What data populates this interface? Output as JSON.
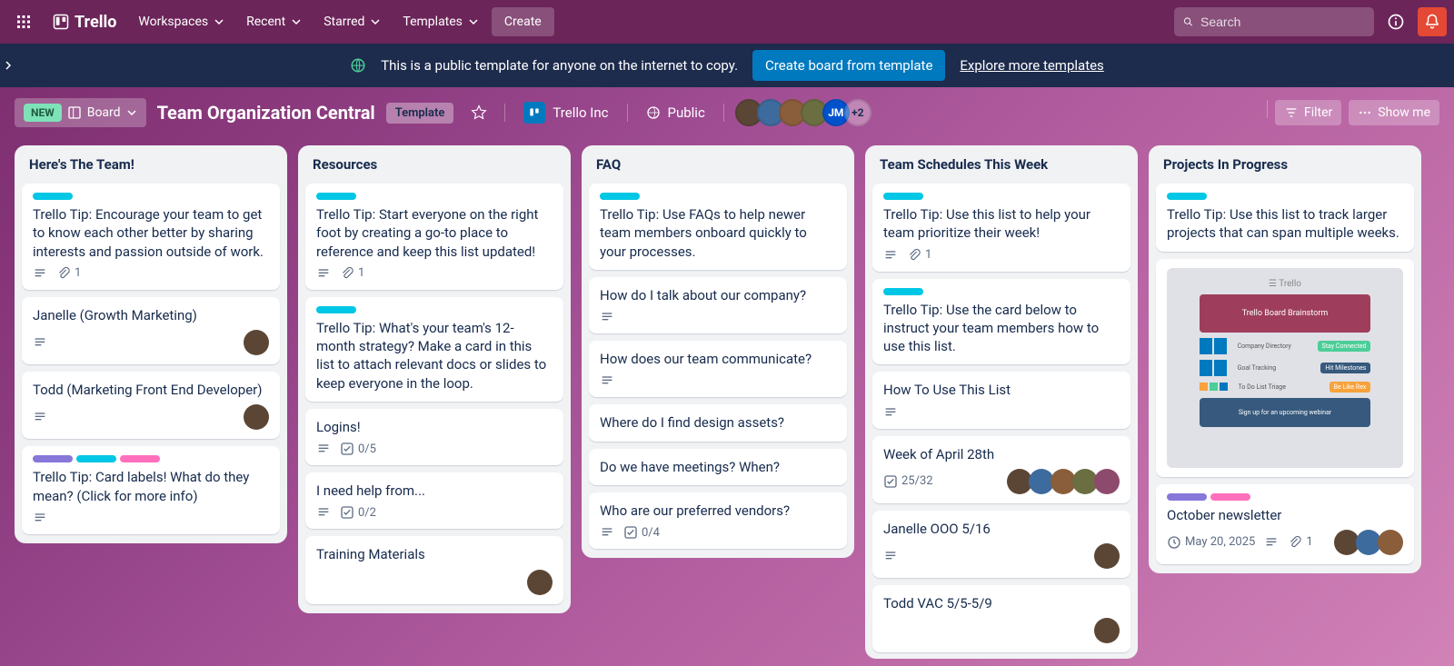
{
  "topnav": {
    "brand": "Trello",
    "menus": [
      "Workspaces",
      "Recent",
      "Starred",
      "Templates"
    ],
    "create": "Create",
    "search_placeholder": "Search"
  },
  "banner": {
    "text": "This is a public template for anyone on the internet to copy.",
    "primary": "Create board from template",
    "link": "Explore more templates"
  },
  "board_header": {
    "badge": "NEW",
    "view": "Board",
    "title": "Team Organization Central",
    "template_chip": "Template",
    "workspace": "Trello Inc",
    "visibility": "Public",
    "member_overflow": "+2",
    "filter": "Filter",
    "show_menu": "Show me"
  },
  "lists": [
    {
      "title": "Here's The Team!",
      "cards": [
        {
          "labels": [
            "cyan"
          ],
          "text": "Trello Tip: Encourage your team to get to know each other better by sharing interests and passion outside of work.",
          "desc": true,
          "attach": "1"
        },
        {
          "text": "Janelle (Growth Marketing)",
          "desc": true,
          "members": 1
        },
        {
          "text": "Todd (Marketing Front End Developer)",
          "desc": true,
          "members": 1
        },
        {
          "labels": [
            "purple",
            "cyan",
            "pink"
          ],
          "text": "Trello Tip: Card labels! What do they mean? (Click for more info)",
          "desc": true
        }
      ]
    },
    {
      "title": "Resources",
      "cards": [
        {
          "labels": [
            "cyan"
          ],
          "text": "Trello Tip: Start everyone on the right foot by creating a go-to place to reference and keep this list updated!",
          "desc": true,
          "attach": "1"
        },
        {
          "labels": [
            "cyan"
          ],
          "text": "Trello Tip: What's your team's 12-month strategy? Make a card in this list to attach relevant docs or slides to keep everyone in the loop."
        },
        {
          "text": "Logins!",
          "desc": true,
          "check": "0/5"
        },
        {
          "text": "I need help from...",
          "desc": true,
          "check": "0/2"
        },
        {
          "text": "Training Materials",
          "members": 1
        }
      ]
    },
    {
      "title": "FAQ",
      "cards": [
        {
          "labels": [
            "cyan"
          ],
          "text": "Trello Tip: Use FAQs to help newer team members onboard quickly to your processes."
        },
        {
          "text": "How do I talk about our company?",
          "desc": true
        },
        {
          "text": "How does our team communicate?",
          "desc": true
        },
        {
          "text": "Where do I find design assets?"
        },
        {
          "text": "Do we have meetings? When?"
        },
        {
          "text": "Who are our preferred vendors?",
          "desc": true,
          "check": "0/4"
        }
      ]
    },
    {
      "title": "Team Schedules This Week",
      "cards": [
        {
          "labels": [
            "cyan"
          ],
          "text": "Trello Tip: Use this list to help your team prioritize their week!",
          "desc": true,
          "attach": "1"
        },
        {
          "labels": [
            "cyan"
          ],
          "text": "Trello Tip: Use the card below to instruct your team members how to use this list."
        },
        {
          "text": "How To Use This List",
          "desc": true
        },
        {
          "text": "Week of April 28th",
          "check": "25/32",
          "members": 5
        },
        {
          "text": "Janelle OOO 5/16",
          "desc": true,
          "members": 1
        },
        {
          "text": "Todd VAC 5/5-5/9",
          "members": 1
        }
      ]
    },
    {
      "title": "Projects In Progress",
      "cards": [
        {
          "labels": [
            "cyan"
          ],
          "text": "Trello Tip: Use this list to track larger projects that can span multiple weeks."
        },
        {
          "cover": true
        },
        {
          "labels": [
            "purple",
            "pink"
          ],
          "text": "October newsletter",
          "date": "May 20, 2025",
          "desc": true,
          "attach": "1",
          "members": 3
        }
      ]
    }
  ],
  "member_initials": "JM"
}
